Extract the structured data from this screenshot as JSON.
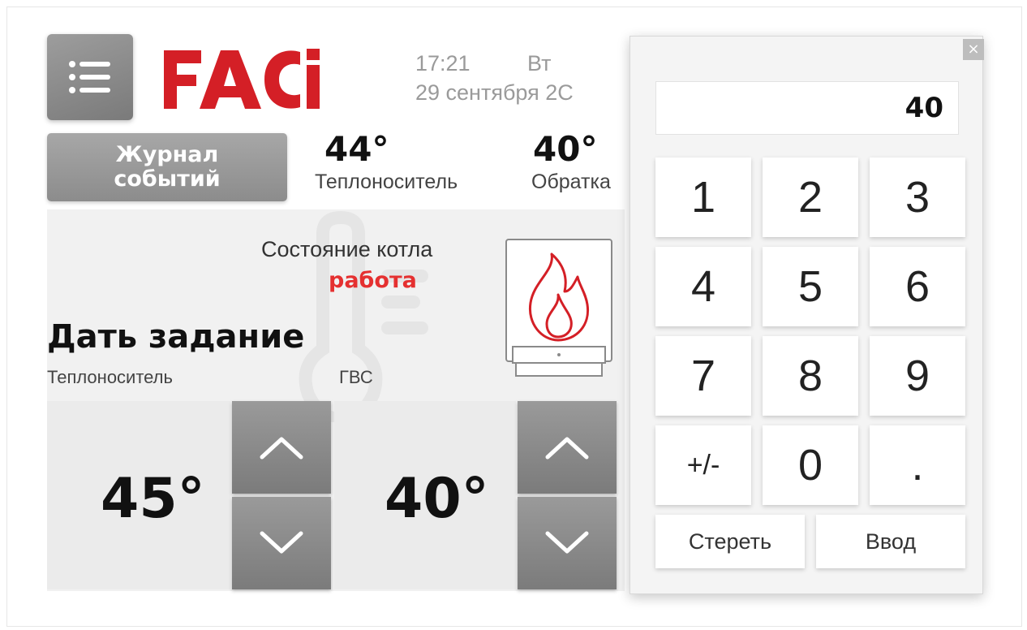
{
  "app": {
    "brand": "FACi",
    "colors": {
      "brand_red": "#d41f26",
      "status_red": "#e53030",
      "button_gray": "#8c8c8c"
    }
  },
  "header": {
    "menu_icon": "list-menu-icon",
    "time": "17:21",
    "weekday": "Вт",
    "date": "29 сентября 2С",
    "event_log_label": "Журнал\nсобытий"
  },
  "readings": [
    {
      "value": "44°",
      "label": "Теплоноситель"
    },
    {
      "value": "40°",
      "label": "Обратка"
    }
  ],
  "boiler": {
    "state_title": "Состояние котла",
    "state_value": "работа",
    "icon": "flame-icon"
  },
  "task": {
    "title": "Дать задание",
    "coolant_label": "Теплоноситель",
    "dhw_label": "ГВС",
    "coolant_setpoint": "45°",
    "dhw_setpoint": "40°"
  },
  "keypad": {
    "display_value": "40",
    "keys": [
      "1",
      "2",
      "3",
      "4",
      "5",
      "6",
      "7",
      "8",
      "9",
      "+/-",
      "0",
      "."
    ],
    "erase_label": "Стереть",
    "enter_label": "Ввод",
    "close_label": "×"
  }
}
